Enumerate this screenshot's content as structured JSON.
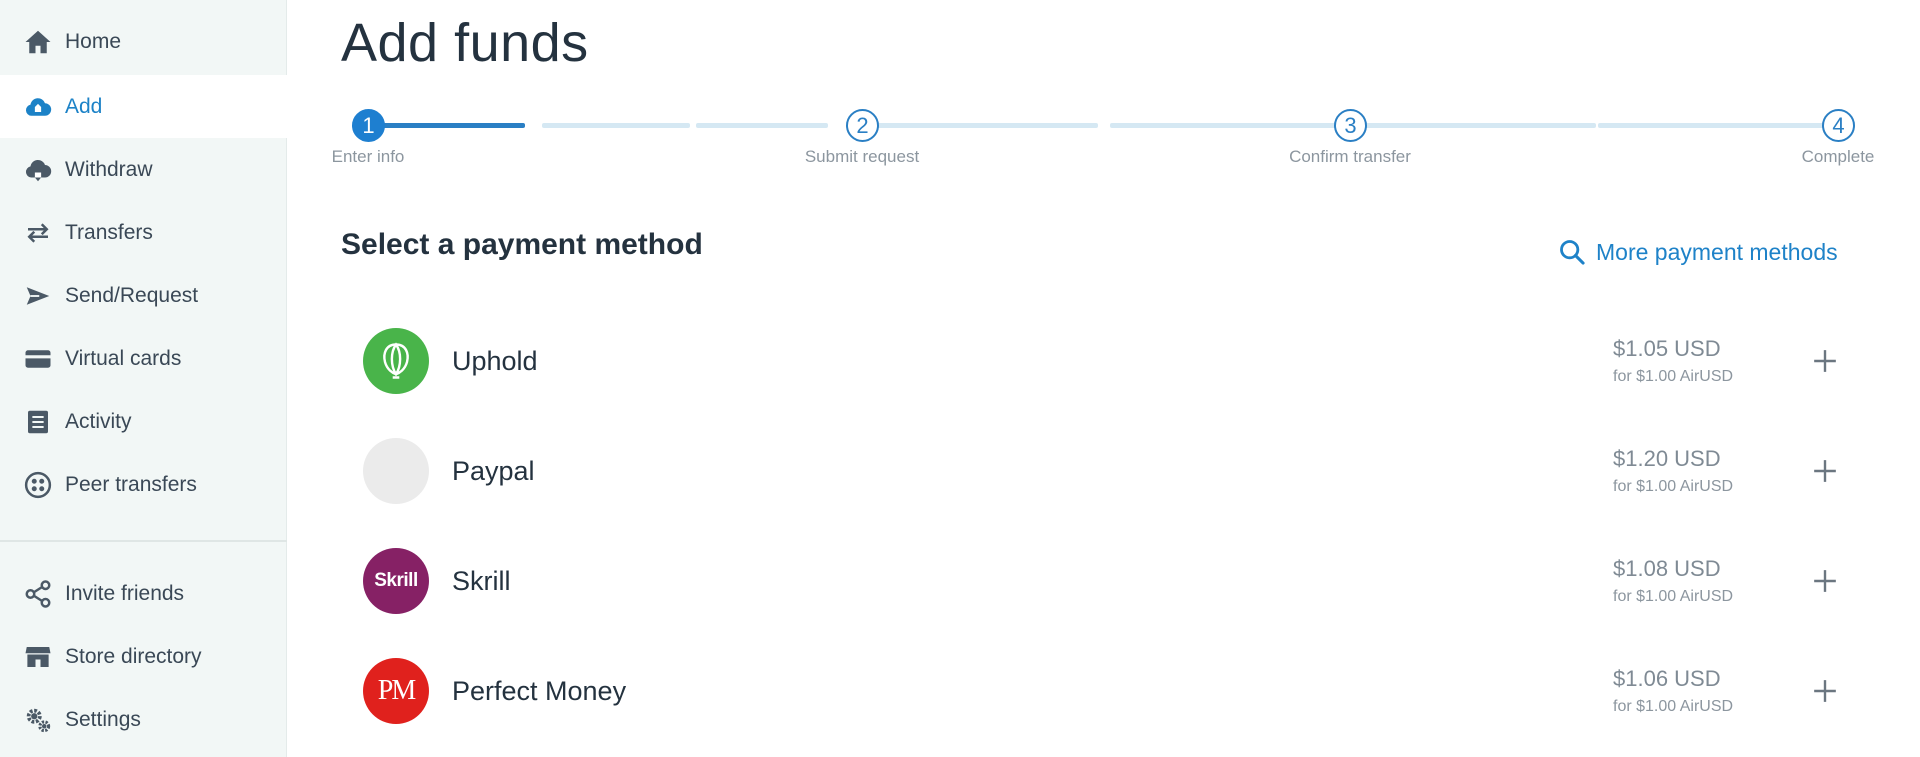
{
  "sidebar": {
    "items": [
      {
        "label": "Home",
        "icon": "home-icon",
        "active": false
      },
      {
        "label": "Add",
        "icon": "cloud-add-icon",
        "active": true
      },
      {
        "label": "Withdraw",
        "icon": "cloud-withdraw-icon",
        "active": false
      },
      {
        "label": "Transfers",
        "icon": "transfer-arrows-icon",
        "active": false
      },
      {
        "label": "Send/Request",
        "icon": "send-icon",
        "active": false
      },
      {
        "label": "Virtual cards",
        "icon": "card-icon",
        "active": false
      },
      {
        "label": "Activity",
        "icon": "document-icon",
        "active": false
      },
      {
        "label": "Peer transfers",
        "icon": "peer-icon",
        "active": false
      }
    ],
    "bottom_items": [
      {
        "label": "Invite friends",
        "icon": "share-icon"
      },
      {
        "label": "Store directory",
        "icon": "store-icon"
      },
      {
        "label": "Settings",
        "icon": "gears-icon"
      }
    ]
  },
  "main": {
    "title": "Add funds",
    "stepper": {
      "steps": [
        {
          "number": "1",
          "label": "Enter info",
          "active": true
        },
        {
          "number": "2",
          "label": "Submit request",
          "active": false
        },
        {
          "number": "3",
          "label": "Confirm transfer",
          "active": false
        },
        {
          "number": "4",
          "label": "Complete",
          "active": false
        }
      ]
    },
    "section_title": "Select a payment method",
    "more_methods_label": "More payment methods",
    "methods": [
      {
        "name": "Uphold",
        "price": "$1.05 USD",
        "for": "for $1.00 AirUSD",
        "logo": "uphold-logo",
        "logo_color": "#49b44a"
      },
      {
        "name": "Paypal",
        "price": "$1.20 USD",
        "for": "for $1.00 AirUSD",
        "logo": "paypal-logo-placeholder",
        "logo_color": "#ebebeb"
      },
      {
        "name": "Skrill",
        "price": "$1.08 USD",
        "for": "for $1.00 AirUSD",
        "logo": "skrill-logo",
        "logo_text": "Skrill",
        "logo_color": "#862165"
      },
      {
        "name": "Perfect Money",
        "price": "$1.06 USD",
        "for": "for $1.00 AirUSD",
        "logo": "perfect-money-logo",
        "logo_text": "PM",
        "logo_color": "#e0211d"
      }
    ]
  },
  "colors": {
    "accent": "#1e82c8",
    "sidebar_bg": "#f2f7f6",
    "text": "#24323f"
  }
}
